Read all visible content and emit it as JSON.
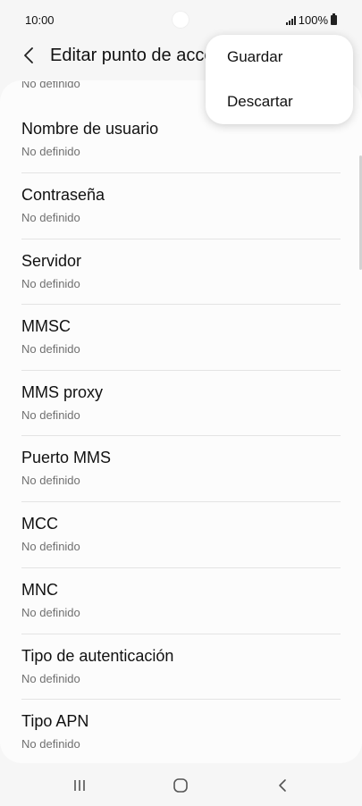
{
  "status_bar": {
    "time": "10:00",
    "battery": "100%"
  },
  "app_bar": {
    "title": "Editar punto de acceso"
  },
  "partial_item": {
    "subtitle": "No definido"
  },
  "items": [
    {
      "title": "Nombre de usuario",
      "subtitle": "No definido"
    },
    {
      "title": "Contraseña",
      "subtitle": "No definido"
    },
    {
      "title": "Servidor",
      "subtitle": "No definido"
    },
    {
      "title": "MMSC",
      "subtitle": "No definido"
    },
    {
      "title": "MMS proxy",
      "subtitle": "No definido"
    },
    {
      "title": "Puerto MMS",
      "subtitle": "No definido"
    },
    {
      "title": "MCC",
      "subtitle": "No definido"
    },
    {
      "title": "MNC",
      "subtitle": "No definido"
    },
    {
      "title": "Tipo de autenticación",
      "subtitle": "No definido"
    },
    {
      "title": "Tipo APN",
      "subtitle": "No definido"
    }
  ],
  "menu": {
    "save": "Guardar",
    "discard": "Descartar"
  },
  "icons": {
    "back": "chevron-left-icon",
    "signal": "signal-icon",
    "battery": "battery-icon",
    "recents": "recents-icon",
    "home": "home-icon",
    "nav_back": "nav-back-icon"
  }
}
